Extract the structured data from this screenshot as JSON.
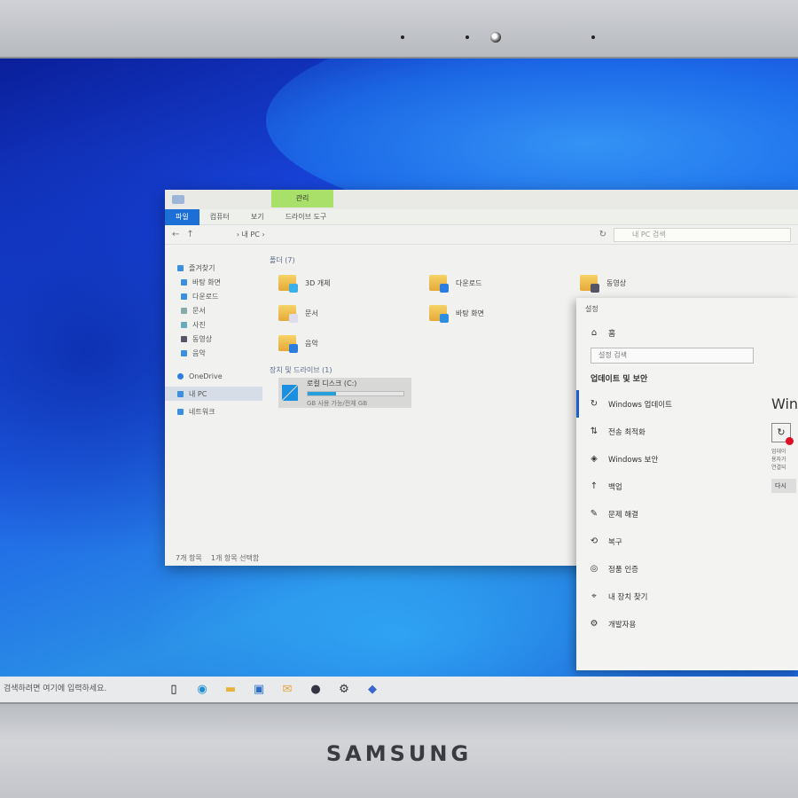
{
  "bezel": {
    "brand": "SAMSUNG"
  },
  "explorer": {
    "manage_tab": "관리",
    "tabs": [
      "파일",
      "컴퓨터",
      "보기",
      "드라이브 도구"
    ],
    "address": "› 내 PC ›",
    "search_placeholder": "내 PC 검색",
    "nav": {
      "quick_access": "즐겨찾기",
      "pinned": [
        "바탕 화면",
        "다운로드",
        "문서",
        "사진",
        "동영상",
        "음악"
      ],
      "onedrive": "OneDrive",
      "this_pc": "내 PC",
      "network": "네트워크"
    },
    "folders_header": "폴더 (7)",
    "folders": [
      "3D 개체",
      "다운로드",
      "동영상",
      "문서",
      "바탕 화면",
      "사진",
      "음악"
    ],
    "devices_header": "장치 및 드라이브 (1)",
    "drive": {
      "name": "로컬 디스크 (C:)",
      "used_fraction": 0.3,
      "free_text": "GB 사용 가능/전체 GB"
    },
    "status": {
      "items": "7개 항목",
      "selected": "1개 항목 선택함"
    }
  },
  "settings": {
    "title": "설정",
    "home": "홈",
    "search_placeholder": "설정 검색",
    "category": "업데이트 및 보안",
    "items": [
      {
        "icon": "sync-icon",
        "label": "Windows 업데이트"
      },
      {
        "icon": "delivery-icon",
        "label": "전송 최적화"
      },
      {
        "icon": "shield-icon",
        "label": "Windows 보안"
      },
      {
        "icon": "backup-icon",
        "label": "백업"
      },
      {
        "icon": "wrench-icon",
        "label": "문제 해결"
      },
      {
        "icon": "recovery-icon",
        "label": "복구"
      },
      {
        "icon": "activation-icon",
        "label": "정품 인증"
      },
      {
        "icon": "find-device-icon",
        "label": "내 장치 찾기"
      },
      {
        "icon": "developer-icon",
        "label": "개발자용"
      }
    ],
    "right_header": "Win",
    "right_text": "업데이\n용자가\n연결되",
    "right_button": "다시"
  },
  "taskbar": {
    "search_placeholder": "검색하려면 여기에 입력하세요.",
    "icons": [
      "task-view-icon",
      "edge-icon",
      "file-explorer-icon",
      "store-icon",
      "mail-icon",
      "browser-icon",
      "settings-icon",
      "app-icon"
    ]
  },
  "colors": {
    "accent": "#1b6fd6",
    "manage_tab": "#a8e06a",
    "drive_fill": "#26a0da"
  }
}
